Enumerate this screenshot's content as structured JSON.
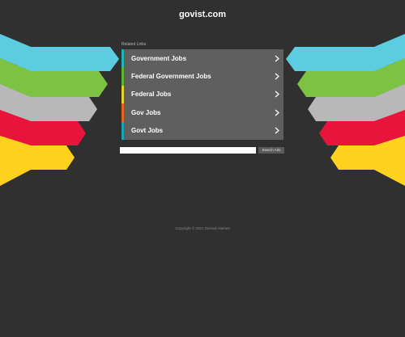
{
  "site": {
    "title": "govist.com"
  },
  "related": {
    "heading": "Related Links"
  },
  "links": [
    {
      "label": "Government Jobs",
      "accent": "#1fb5b5"
    },
    {
      "label": "Federal Government Jobs",
      "accent": "#5ab534"
    },
    {
      "label": "Federal Jobs",
      "accent": "#e3d622"
    },
    {
      "label": "Gov Jobs",
      "accent": "#e8641e"
    },
    {
      "label": "Govt Jobs",
      "accent": "#1aa3b0"
    }
  ],
  "search": {
    "input_value": "",
    "button_label": "Search Ads"
  },
  "footer": {
    "text": "Copyright © 2021 Domain Names"
  },
  "decoration": {
    "colors": [
      "#5ccde0",
      "#7cc243",
      "#b8b8b8",
      "#e8143c",
      "#ffd21e"
    ],
    "icons": [
      "left-arrow-stripes-decoration",
      "right-arrow-stripes-decoration",
      "chevron-right-icon"
    ]
  }
}
